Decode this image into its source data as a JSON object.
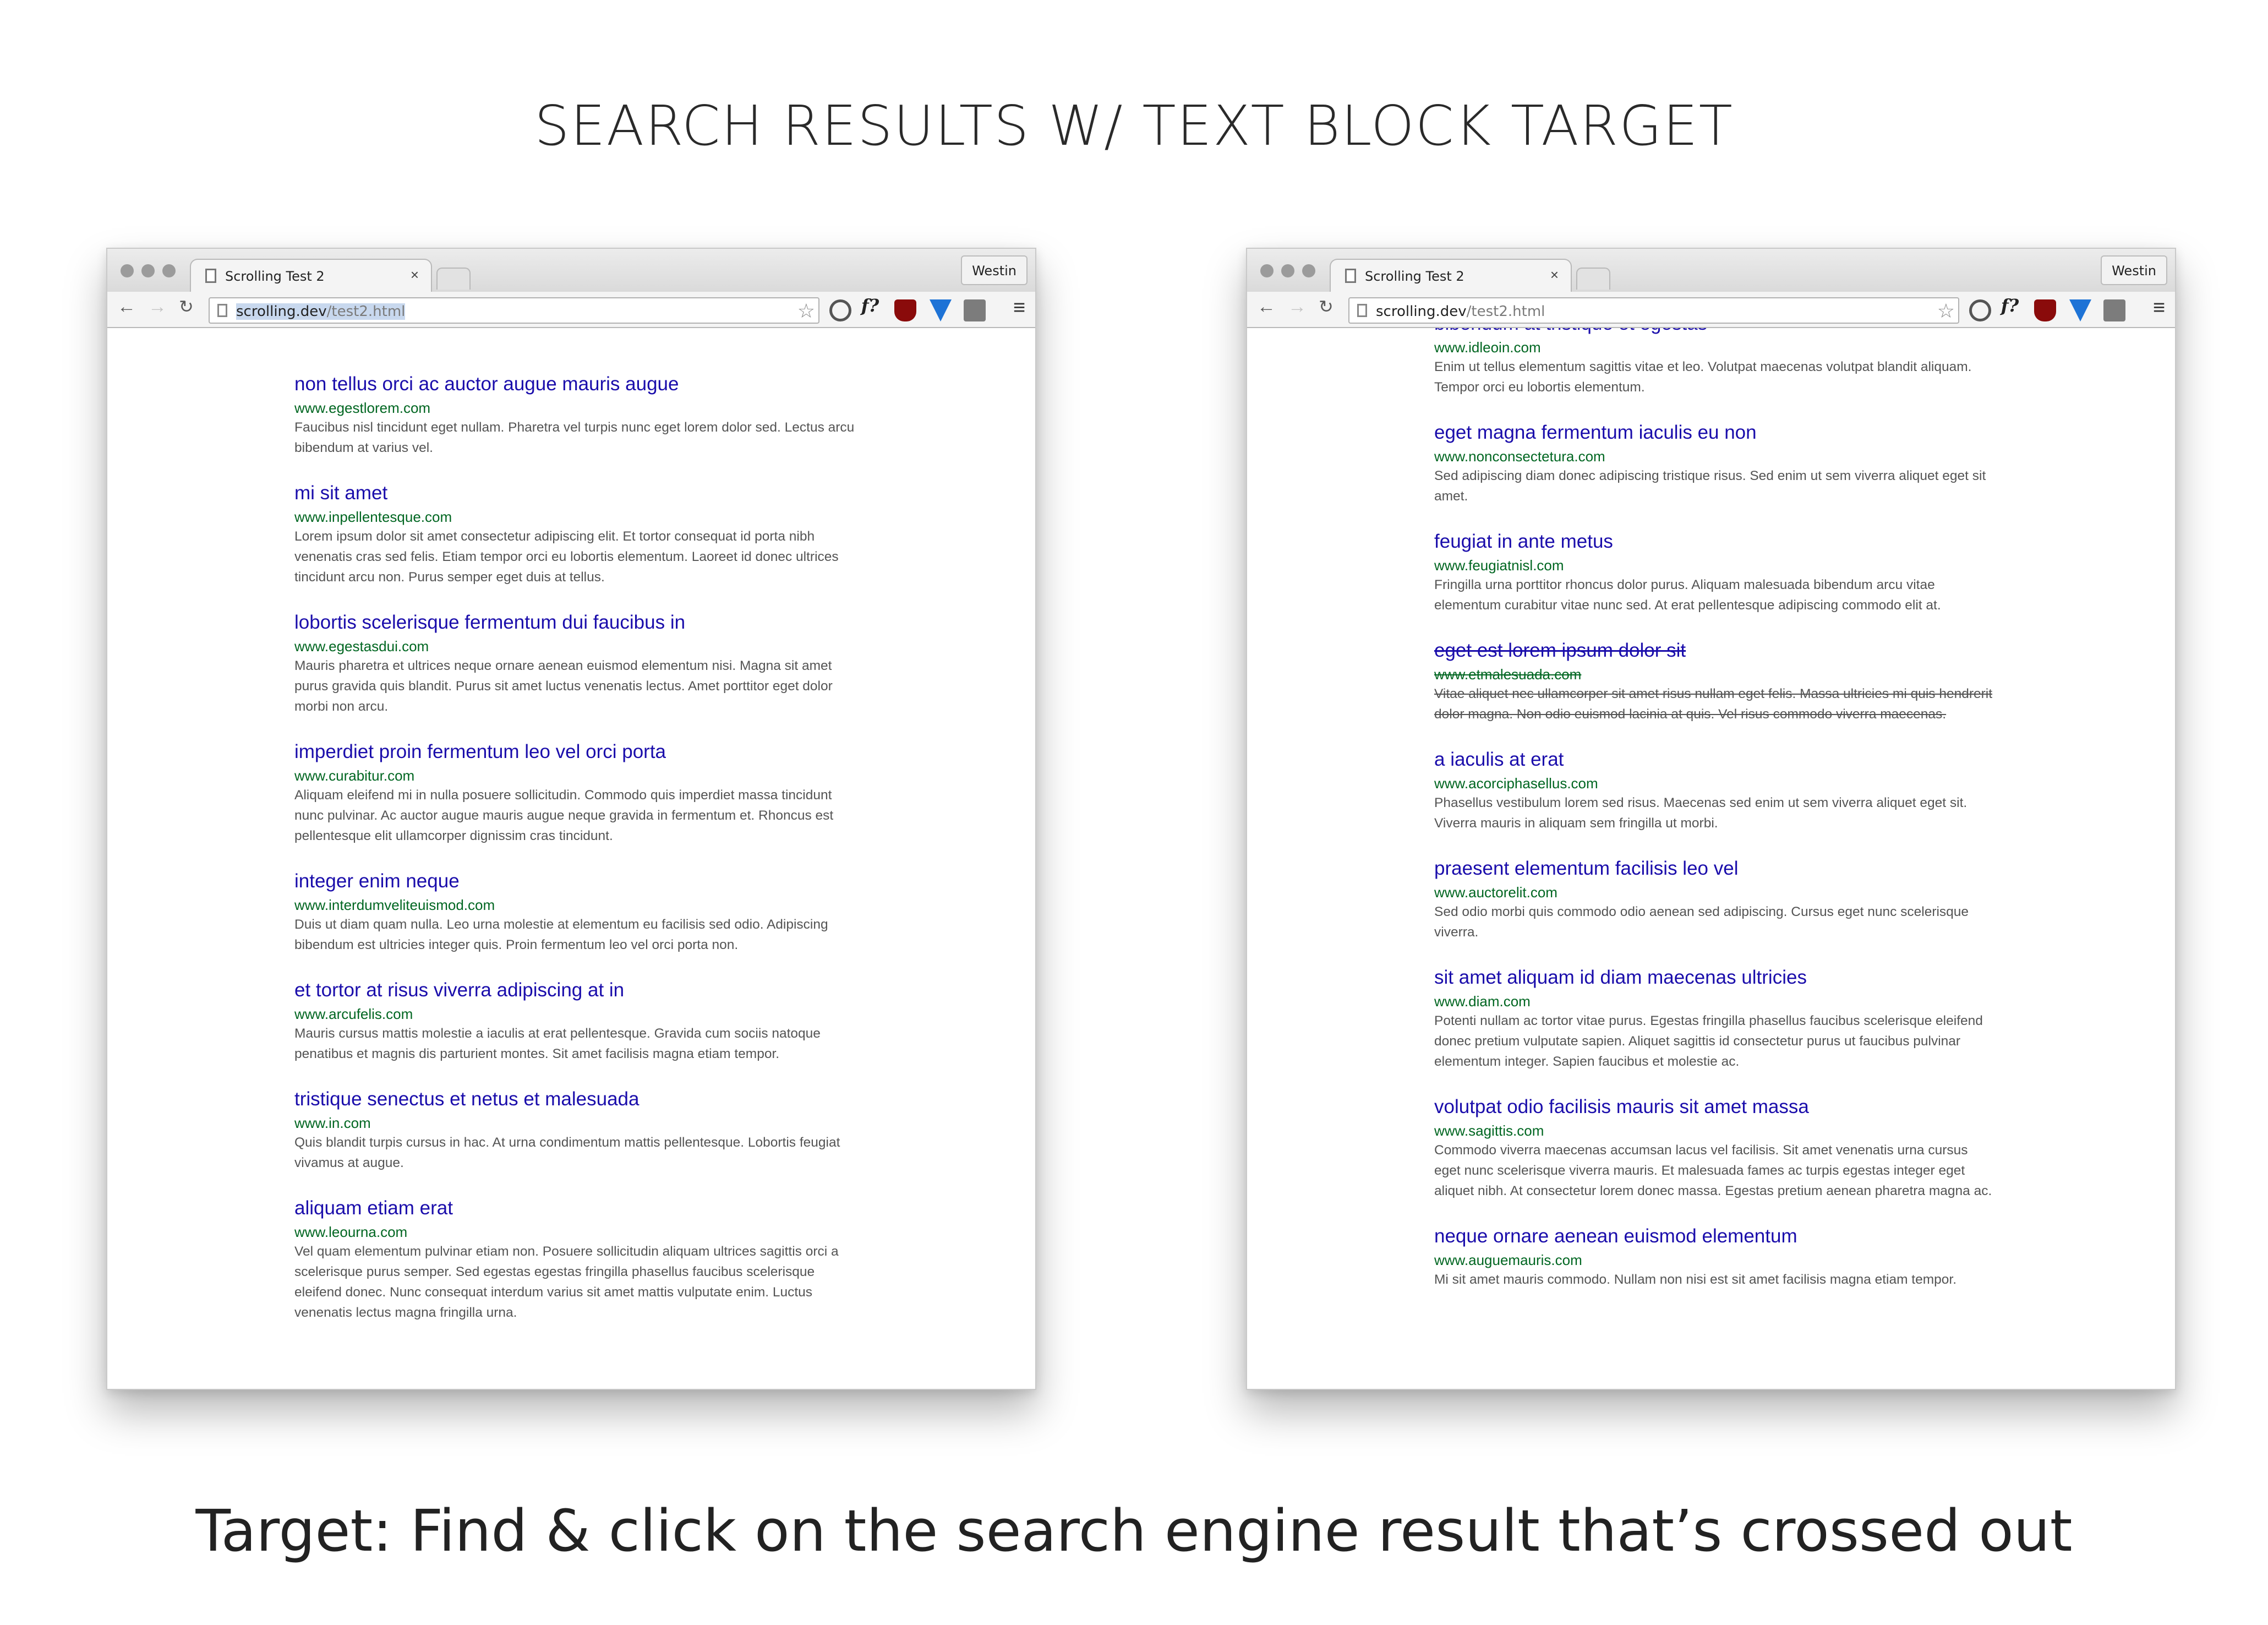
{
  "page": {
    "heading": "SEARCH RESULTS W/ TEXT BLOCK TARGET",
    "caption": "Target: Find & click on the search engine result that’s crossed out"
  },
  "browser": {
    "tab_title": "Scrolling Test 2",
    "tab_close": "×",
    "profile_name": "Westin",
    "url_host": "scrolling.dev",
    "url_path": "/test2.html",
    "back_glyph": "←",
    "forward_glyph": "→",
    "reload_glyph": "↻",
    "star_glyph": "☆",
    "menu_glyph": "≡",
    "extension_f_label": "f?",
    "icons": [
      "page-icon",
      "sync-icon",
      "f-question-icon",
      "ublock-icon",
      "v-extension-icon",
      "extension-box-icon",
      "hamburger-menu-icon"
    ]
  },
  "left_results": [
    {
      "title": "non tellus orci ac auctor augue mauris augue",
      "url": "www.egestlorem.com",
      "snippet": "Faucibus nisl tincidunt eget nullam. Pharetra vel turpis nunc eget lorem dolor sed. Lectus arcu bibendum at varius vel."
    },
    {
      "title": "mi sit amet",
      "url": "www.inpellentesque.com",
      "snippet": "Lorem ipsum dolor sit amet consectetur adipiscing elit. Et tortor consequat id porta nibh venenatis cras sed felis. Etiam tempor orci eu lobortis elementum. Laoreet id donec ultrices tincidunt arcu non. Purus semper eget duis at tellus."
    },
    {
      "title": "lobortis scelerisque fermentum dui faucibus in",
      "url": "www.egestasdui.com",
      "snippet": "Mauris pharetra et ultrices neque ornare aenean euismod elementum nisi. Magna sit amet purus gravida quis blandit. Purus sit amet luctus venenatis lectus. Amet porttitor eget dolor morbi non arcu."
    },
    {
      "title": "imperdiet proin fermentum leo vel orci porta",
      "url": "www.curabitur.com",
      "snippet": "Aliquam eleifend mi in nulla posuere sollicitudin. Commodo quis imperdiet massa tincidunt nunc pulvinar. Ac auctor augue mauris augue neque gravida in fermentum et. Rhoncus est pellentesque elit ullamcorper dignissim cras tincidunt."
    },
    {
      "title": "integer enim neque",
      "url": "www.interdumveliteuismod.com",
      "snippet": "Duis ut diam quam nulla. Leo urna molestie at elementum eu facilisis sed odio. Adipiscing bibendum est ultricies integer quis. Proin fermentum leo vel orci porta non."
    },
    {
      "title": "et tortor at risus viverra adipiscing at in",
      "url": "www.arcufelis.com",
      "snippet": "Mauris cursus mattis molestie a iaculis at erat pellentesque. Gravida cum sociis natoque penatibus et magnis dis parturient montes. Sit amet facilisis magna etiam tempor."
    },
    {
      "title": "tristique senectus et netus et malesuada",
      "url": "www.in.com",
      "snippet": "Quis blandit turpis cursus in hac. At urna condimentum mattis pellentesque. Lobortis feugiat vivamus at augue."
    },
    {
      "title": "aliquam etiam erat",
      "url": "www.leourna.com",
      "snippet": "Vel quam elementum pulvinar etiam non. Posuere sollicitudin aliquam ultrices sagittis orci a scelerisque purus semper. Sed egestas egestas fringilla phasellus faucibus scelerisque eleifend donec. Nunc consequat interdum varius sit amet mattis vulputate enim. Luctus venenatis lectus magna fringilla urna."
    }
  ],
  "right_results": [
    {
      "title": "bibendum at tristique et egestas",
      "url": "www.idleoin.com",
      "snippet": "Enim ut tellus elementum sagittis vitae et leo. Volutpat maecenas volutpat blandit aliquam. Tempor orci eu lobortis elementum."
    },
    {
      "title": "eget magna fermentum iaculis eu non",
      "url": "www.nonconsectetura.com",
      "snippet": "Sed adipiscing diam donec adipiscing tristique risus. Sed enim ut sem viverra aliquet eget sit amet."
    },
    {
      "title": "feugiat in ante metus",
      "url": "www.feugiatnisl.com",
      "snippet": "Fringilla urna porttitor rhoncus dolor purus. Aliquam malesuada bibendum arcu vitae elementum curabitur vitae nunc sed. At erat pellentesque adipiscing commodo elit at."
    },
    {
      "title": "eget est lorem ipsum dolor sit",
      "url": "www.etmalesuada.com",
      "snippet": "Vitae aliquet nec ullamcorper sit amet risus nullam eget felis. Massa ultricies mi quis hendrerit dolor magna. Non odio euismod lacinia at quis. Vel risus commodo viverra maecenas.",
      "crossed_out": true
    },
    {
      "title": "a iaculis at erat",
      "url": "www.acorciphasellus.com",
      "snippet": "Phasellus vestibulum lorem sed risus. Maecenas sed enim ut sem viverra aliquet eget sit. Viverra mauris in aliquam sem fringilla ut morbi."
    },
    {
      "title": "praesent elementum facilisis leo vel",
      "url": "www.auctorelit.com",
      "snippet": "Sed odio morbi quis commodo odio aenean sed adipiscing. Cursus eget nunc scelerisque viverra."
    },
    {
      "title": "sit amet aliquam id diam maecenas ultricies",
      "url": "www.diam.com",
      "snippet": "Potenti nullam ac tortor vitae purus. Egestas fringilla phasellus faucibus scelerisque eleifend donec pretium vulputate sapien. Aliquet sagittis id consectetur purus ut faucibus pulvinar elementum integer. Sapien faucibus et molestie ac."
    },
    {
      "title": "volutpat odio facilisis mauris sit amet massa",
      "url": "www.sagittis.com",
      "snippet": "Commodo viverra maecenas accumsan lacus vel facilisis. Sit amet venenatis urna cursus eget nunc scelerisque viverra mauris. Et malesuada fames ac turpis egestas integer eget aliquet nibh. At consectetur lorem donec massa. Egestas pretium aenean pharetra magna ac."
    },
    {
      "title": "neque ornare aenean euismod elementum",
      "url": "www.auguemauris.com",
      "snippet": "Mi sit amet mauris commodo. Nullam non nisi est sit amet facilisis magna etiam tempor."
    }
  ]
}
